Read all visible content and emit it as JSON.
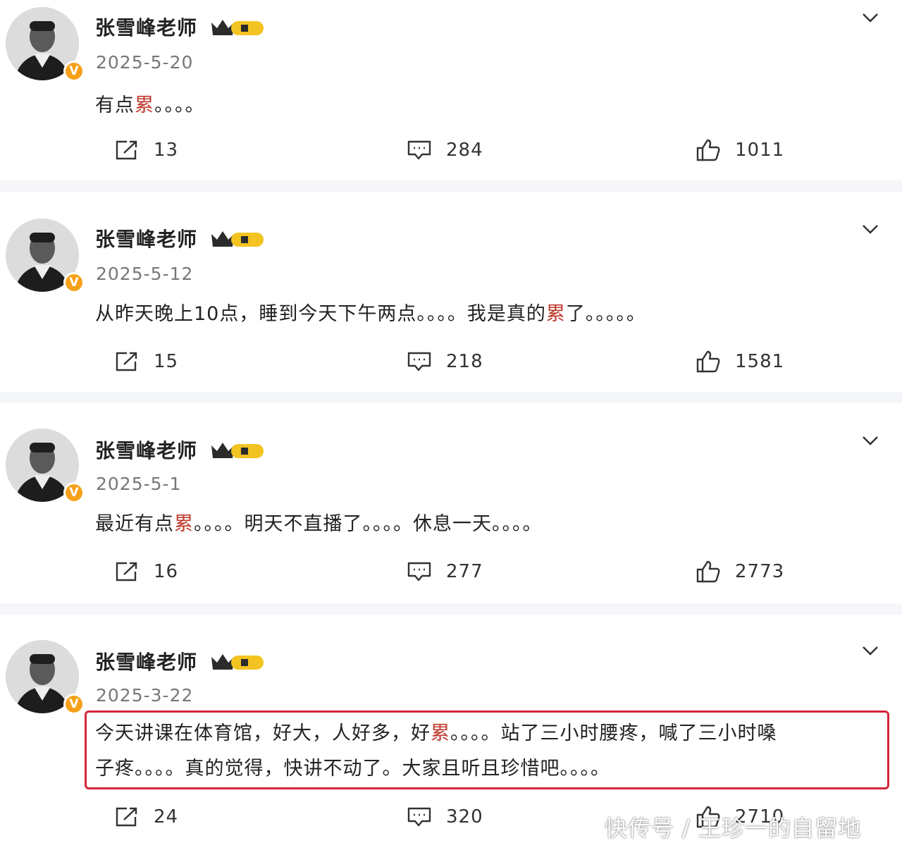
{
  "posts": [
    {
      "author": "张雪峰老师",
      "vip_label": "❙",
      "verified_mark": "V",
      "date": "2025-5-20",
      "content_parts": [
        "有点",
        "累",
        "。。。。"
      ],
      "shares": "13",
      "comments": "284",
      "likes": "1011"
    },
    {
      "author": "张雪峰老师",
      "verified_mark": "V",
      "date": "2025-5-12",
      "content_parts": [
        "从昨天晚上10点，睡到今天下午两点。。。。我是真的",
        "累",
        "了。。。。。"
      ],
      "shares": "15",
      "comments": "218",
      "likes": "1581"
    },
    {
      "author": "张雪峰老师",
      "verified_mark": "V",
      "date": "2025-5-1",
      "content_parts": [
        "最近有点",
        "累",
        "。。。。明天不直播了。。。。休息一天。。。。"
      ],
      "shares": "16",
      "comments": "277",
      "likes": "2773"
    },
    {
      "author": "张雪峰老师",
      "verified_mark": "V",
      "date": "2025-3-22",
      "content_line1_parts": [
        "今天讲课在体育馆，好大，人好多，好",
        "累",
        "。。。。站了三小时腰疼，喊了三小时嗓"
      ],
      "content_line2": "子疼。。。。真的觉得，快讲不动了。大家且听且珍惜吧。。。。",
      "shares": "24",
      "comments": "320",
      "likes": "2710"
    }
  ],
  "watermark": "快传号 / 王珍一的自留地",
  "icons": {
    "share": "share-icon",
    "comment": "comment-icon",
    "like": "thumbs-up-icon",
    "more": "chevron-down-icon",
    "vip": "crown-vip-badge-icon",
    "verified": "verified-badge-icon"
  },
  "colors": {
    "accent_red": "#c0392b",
    "highlight_border": "#d3263a",
    "verified_orange": "#f7a11a",
    "vip_gold": "#f3c321"
  }
}
